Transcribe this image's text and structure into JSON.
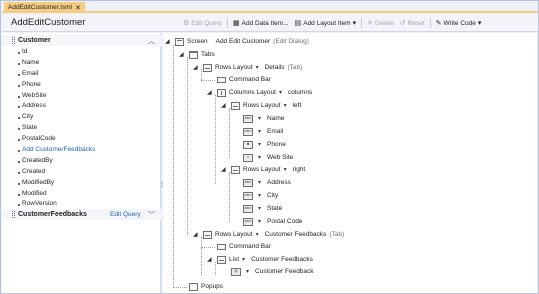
{
  "document_tab": {
    "title": "AddEditCustomer.lsml",
    "close_glyph": "✕"
  },
  "designer": {
    "title": "AddEditCustomer"
  },
  "toolbar": {
    "edit_query": "Edit Query",
    "add_data_item": "Add Data Item...",
    "add_layout_item": "Add Layout Item",
    "delete": "Delete",
    "reset": "Reset",
    "write_code": "Write Code"
  },
  "left_panel": {
    "customer_entity": "Customer",
    "properties": [
      "Id",
      "Name",
      "Email",
      "Phone",
      "WebSite",
      "Address",
      "City",
      "State",
      "PostalCode",
      "Add CustomerFeedbacks",
      "CreatedBy",
      "Created",
      "ModifiedBy",
      "Modified",
      "RowVersion"
    ],
    "feedbacks_entity": "CustomerFeedbacks",
    "feedbacks_action": "Edit Query"
  },
  "tree": {
    "screen": {
      "label": "Screen",
      "name": "Add Edit Customer",
      "hint": "(Edit Dialog)"
    },
    "tabs": "Tabs",
    "rows_layout": "Rows Layout",
    "details": "Details",
    "tab_hint": "(Tab)",
    "command_bar": "Command Bar",
    "columns_layout": "Columns Layout",
    "columns": "columns",
    "left": "left",
    "right": "right",
    "left_fields": [
      "Name",
      "Email",
      "Phone",
      "Web Site"
    ],
    "right_fields": [
      "Address",
      "City",
      "State",
      "Postal Code"
    ],
    "customer_feedbacks": "Customer Feedbacks",
    "list": "List",
    "customer_feedback": "Customer Feedback",
    "popups": "Popups"
  },
  "colors": {
    "tab_accent": "#f5cc84",
    "link": "#1e64b4",
    "disabled": "#a2a7b0"
  }
}
